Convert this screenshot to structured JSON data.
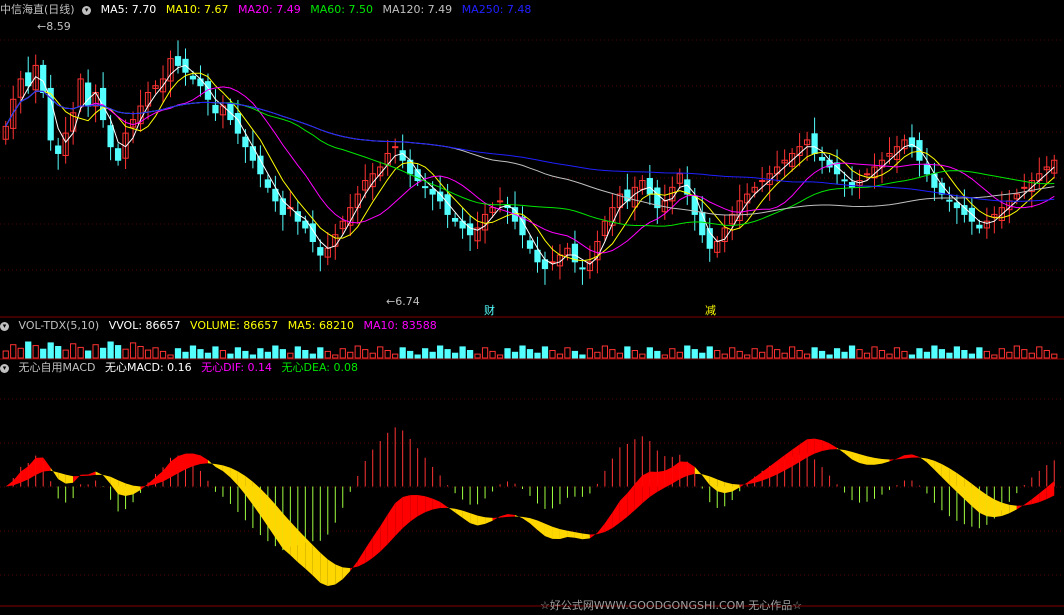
{
  "main_header": {
    "title": "中信海直(日线)",
    "ma5": "MA5: 7.70",
    "ma10": "MA10: 7.67",
    "ma20": "MA20: 7.49",
    "ma60": "MA60: 7.50",
    "ma120": "MA120: 7.49",
    "ma250": "MA250: 7.48"
  },
  "vol_header": {
    "title": "VOL-TDX(5,10)",
    "vvol": "VVOL: 86657",
    "volume": "VOLUME: 86657",
    "ma5": "MA5: 68210",
    "ma10": "MA10: 83588"
  },
  "macd_header": {
    "title": "无心自用MACD",
    "macd": "无心MACD: 0.16",
    "dif": "无心DIF: 0.14",
    "dea": "无心DEA: 0.08"
  },
  "annotations": {
    "high": "8.59",
    "low": "6.74",
    "event1": "财",
    "event2": "减"
  },
  "footer": "☆好公式网WWW.GOODGONGSHI.COM 无心作品☆",
  "colors": {
    "up": "#ff3333",
    "down": "#54ffff",
    "ma5": "#ffffff",
    "ma10": "#ffff00",
    "ma20": "#ff00ff",
    "ma60": "#00e600",
    "ma120": "#c0c0c0",
    "ma250": "#2020ff",
    "hist_pos": "#ff3333",
    "hist_neg": "#a0ff40",
    "band_up": "#ff0000",
    "band_down": "#ffd700"
  },
  "chart_data": {
    "type": "candlestick",
    "title": "中信海直(日线)",
    "ylim": [
      6.55,
      8.75
    ],
    "high_mark": 8.59,
    "low_mark": 6.74,
    "closes": [
      7.95,
      8.15,
      8.3,
      8.25,
      8.4,
      8.2,
      7.85,
      7.75,
      7.9,
      8.05,
      8.3,
      8.1,
      8.2,
      8.0,
      7.8,
      7.7,
      7.9,
      8.0,
      8.1,
      8.2,
      8.25,
      8.3,
      8.45,
      8.4,
      8.35,
      8.3,
      8.25,
      8.15,
      8.05,
      8.1,
      8.0,
      7.9,
      7.8,
      7.7,
      7.6,
      7.5,
      7.4,
      7.3,
      7.35,
      7.25,
      7.2,
      7.1,
      7.0,
      7.05,
      7.15,
      7.25,
      7.35,
      7.45,
      7.55,
      7.6,
      7.65,
      7.75,
      7.8,
      7.7,
      7.6,
      7.55,
      7.5,
      7.45,
      7.4,
      7.3,
      7.25,
      7.2,
      7.15,
      7.2,
      7.3,
      7.35,
      7.4,
      7.35,
      7.25,
      7.15,
      7.05,
      6.95,
      6.9,
      6.95,
      7.0,
      7.05,
      6.95,
      6.9,
      6.95,
      7.1,
      7.25,
      7.35,
      7.45,
      7.4,
      7.5,
      7.55,
      7.45,
      7.35,
      7.4,
      7.5,
      7.6,
      7.45,
      7.3,
      7.15,
      7.05,
      7.1,
      7.2,
      7.3,
      7.4,
      7.45,
      7.5,
      7.55,
      7.6,
      7.65,
      7.7,
      7.75,
      7.8,
      7.85,
      7.75,
      7.7,
      7.65,
      7.6,
      7.55,
      7.5,
      7.55,
      7.6,
      7.65,
      7.7,
      7.75,
      7.8,
      7.85,
      7.8,
      7.7,
      7.6,
      7.5,
      7.45,
      7.4,
      7.35,
      7.3,
      7.25,
      7.2,
      7.25,
      7.3,
      7.35,
      7.4,
      7.45,
      7.5,
      7.55,
      7.6,
      7.65,
      7.7
    ],
    "ma_last": {
      "MA5": 7.7,
      "MA10": 7.67,
      "MA20": 7.49,
      "MA60": 7.5,
      "MA120": 7.49,
      "MA250": 7.48
    },
    "volume": {
      "VVOL": 86657,
      "MA5": 68210,
      "MA10": 83588
    },
    "macd": {
      "MACD": 0.16,
      "DIF": 0.14,
      "DEA": 0.08
    }
  }
}
